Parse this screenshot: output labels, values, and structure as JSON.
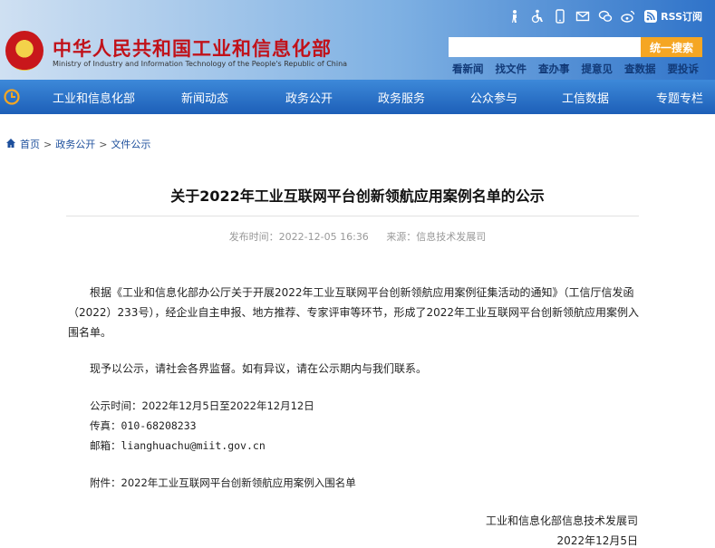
{
  "header": {
    "logo_cn": "中华人民共和国工业和信息化部",
    "logo_en": "Ministry of Industry and Information Technology of the People's Republic of China",
    "rss_label": "RSS订阅",
    "search_placeholder": "",
    "search_button": "统一搜索",
    "quick_links": [
      "看新闻",
      "找文件",
      "查办事",
      "提意见",
      "查数据",
      "要投诉"
    ]
  },
  "nav": {
    "items": [
      "工业和信息化部",
      "新闻动态",
      "政务公开",
      "政务服务",
      "公众参与",
      "工信数据",
      "专题专栏"
    ]
  },
  "breadcrumb": [
    "首页",
    "政务公开",
    "文件公示"
  ],
  "article": {
    "title": "关于2022年工业互联网平台创新领航应用案例名单的公示",
    "publish_label": "发布时间：2022-12-05 16:36",
    "source_label": "来源：信息技术发展司",
    "paragraph1": "根据《工业和信息化部办公厅关于开展2022年工业互联网平台创新领航应用案例征集活动的通知》（工信厅信发函（2022）233号），经企业自主申报、地方推荐、专家评审等环节，形成了2022年工业互联网平台创新领航应用案例入围名单。",
    "paragraph2": "现予以公示，请社会各界监督。如有异议，请在公示期内与我们联系。",
    "period_label": "公示时间：",
    "period_value": "2022年12月5日至2022年12月12日",
    "fax_label": "传真：",
    "fax_value": "010-68208233",
    "email_label": "邮箱：",
    "email_value": "lianghuachu@miit.gov.cn",
    "attachment_label": "附件：",
    "attachment_value": "2022年工业互联网平台创新领航应用案例入围名单",
    "sign_org": "工业和信息化部信息技术发展司",
    "sign_date": "2022年12月5日"
  }
}
